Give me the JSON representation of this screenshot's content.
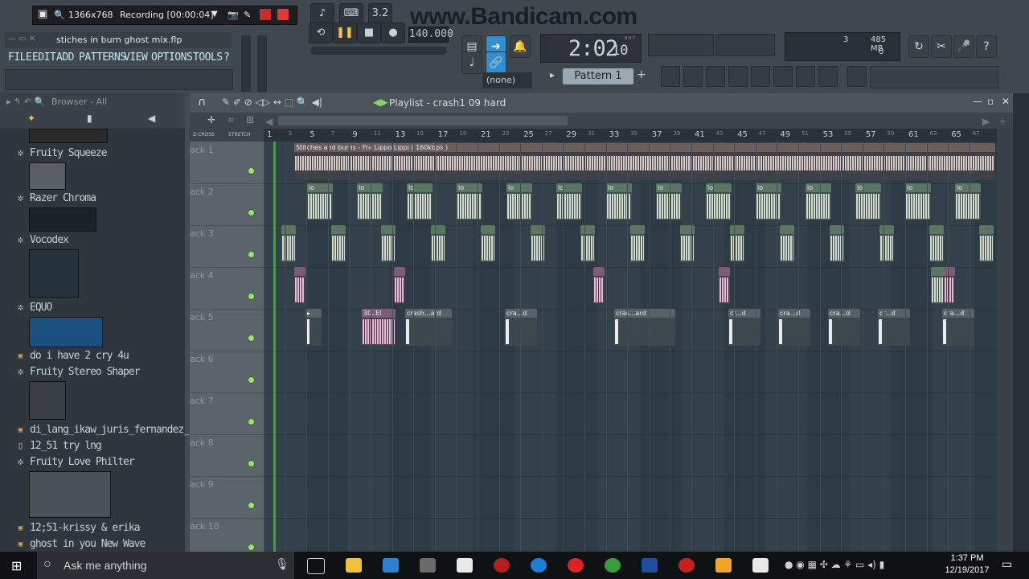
{
  "recorder": {
    "resolution": "1366x768",
    "status": "Recording [00:00:04]"
  },
  "watermark": "www.Bandicam.com",
  "project": {
    "filename": "stiches in burn ghost mix.flp"
  },
  "menu": [
    "FILE",
    "EDIT",
    "ADD",
    "PATTERNS",
    "VIEW",
    "OPTIONS",
    "TOOLS",
    "?"
  ],
  "transport": {
    "tempo": "140.000",
    "time": "2:02",
    "time_sub": "10",
    "time_unit": "B:S:T",
    "pattern": "Pattern 1",
    "pattern_add": "+",
    "snap": "(none)"
  },
  "cpu": {
    "cores": "3",
    "memory": "485 MB",
    "poly": "0"
  },
  "browser": {
    "title": "Browser - All",
    "items": [
      {
        "icon": "gear-icon",
        "label": "Fruity Squeeze"
      },
      {
        "icon": "gear-icon",
        "label": "Razer Chroma"
      },
      {
        "icon": "gear-icon",
        "label": "Vocodex"
      },
      {
        "icon": "gear-icon",
        "label": "EQUO"
      },
      {
        "icon": "file-icon",
        "label": "do i have 2 cry 4u"
      },
      {
        "icon": "gear-icon",
        "label": "Fruity Stereo Shaper"
      },
      {
        "icon": "file-icon",
        "label": "di_lang_ikaw_juris_fernandez_lyrics"
      },
      {
        "icon": "doc-icon",
        "label": "12_51 try lng"
      },
      {
        "icon": "gear-icon",
        "label": "Fruity Love Philter"
      },
      {
        "icon": "file-icon",
        "label": "12;51-krissy & erika"
      },
      {
        "icon": "file-icon",
        "label": "ghost in you New Wave"
      }
    ]
  },
  "playlist": {
    "title": "Playlist - crash1 09 hard",
    "zcross": "Z-CROSS",
    "stretch": "STRETCH",
    "ruler": [
      "1",
      "3",
      "5",
      "7",
      "9",
      "11",
      "13",
      "15",
      "17",
      "19",
      "21",
      "23",
      "25",
      "27",
      "29",
      "31",
      "33",
      "35",
      "37",
      "39",
      "41",
      "43",
      "45",
      "47",
      "49",
      "51",
      "53",
      "55",
      "57",
      "59",
      "61",
      "63",
      "65",
      "67"
    ],
    "tracks": [
      "ack 1",
      "ack 2",
      "ack 3",
      "ack 4",
      "ack 5",
      "ack 6",
      "ack 7",
      "ack 8",
      "ack 9",
      "ack 10"
    ],
    "long_clip_label": "Stitches and burns - Fra Lippo Lippi ( 160kbps )",
    "clip_labels": {
      "track2": "lo",
      "track5_a": "30..El",
      "track5_b": "crash...ard",
      "track5_c": "cra...d",
      "track5_d": "cras...ard",
      "track5_e": "cr...d"
    }
  },
  "taskbar": {
    "search_placeholder": "Ask me anything",
    "time": "1:37 PM",
    "date": "12/19/2017"
  }
}
